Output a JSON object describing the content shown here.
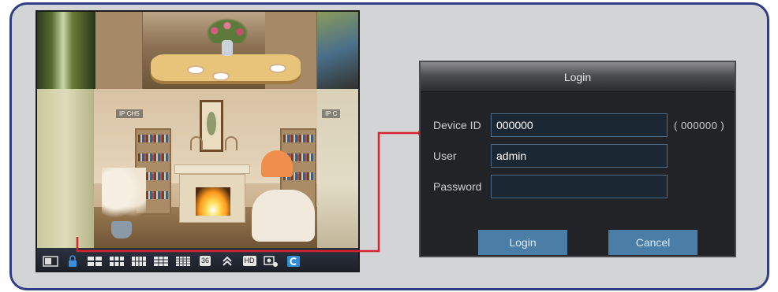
{
  "live_view": {
    "channel_labels": [
      "IP CH5",
      "IP C"
    ]
  },
  "toolbar": {
    "items": [
      {
        "name": "screen-icon"
      },
      {
        "name": "lock-icon"
      },
      {
        "name": "layout-4-icon"
      },
      {
        "name": "layout-6-icon"
      },
      {
        "name": "layout-8-icon"
      },
      {
        "name": "layout-9-icon"
      },
      {
        "name": "layout-16-icon"
      },
      {
        "name": "layout-36",
        "label": "36"
      },
      {
        "name": "double-chevron-up-icon"
      },
      {
        "name": "hd-toggle",
        "label": "HD"
      },
      {
        "name": "search-settings-icon"
      },
      {
        "name": "cloud-connect-icon"
      }
    ]
  },
  "dialog": {
    "title": "Login",
    "device_id_label": "Device ID",
    "device_id_value": "000000",
    "device_id_hint": "( 000000 )",
    "user_label": "User",
    "user_value": "admin",
    "password_label": "Password",
    "password_value": "",
    "login_button": "Login",
    "cancel_button": "Cancel"
  },
  "colors": {
    "frame_border": "#2f3f86",
    "connector": "#d6232f",
    "button": "#4a7ea6",
    "field_border": "#4b6d8a"
  }
}
